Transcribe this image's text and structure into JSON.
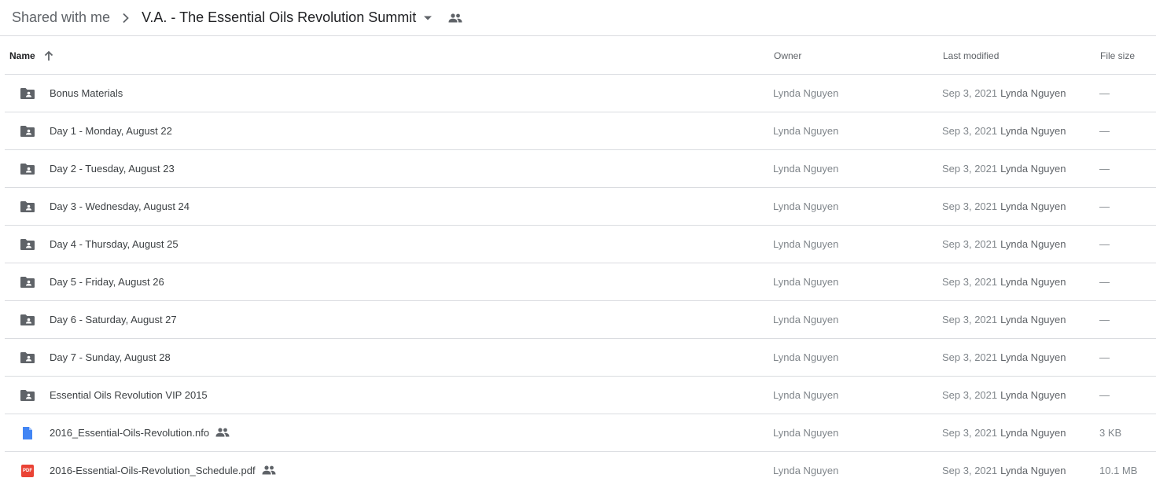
{
  "breadcrumb": {
    "root": "Shared with me",
    "current": "V.A. - The Essential Oils Revolution Summit",
    "icons": [
      "chevron-right-icon",
      "dropdown-arrow-icon",
      "shared-people-icon"
    ]
  },
  "table": {
    "headers": {
      "name": "Name",
      "owner": "Owner",
      "modified": "Last modified",
      "size": "File size"
    },
    "sort": "name-ascending",
    "rows": [
      {
        "type": "shared-folder",
        "name": "Bonus Materials",
        "shared": false,
        "owner": "Lynda Nguyen",
        "date": "Sep 3, 2021",
        "by": "Lynda Nguyen",
        "size": "—"
      },
      {
        "type": "shared-folder",
        "name": "Day 1 - Monday, August 22",
        "shared": false,
        "owner": "Lynda Nguyen",
        "date": "Sep 3, 2021",
        "by": "Lynda Nguyen",
        "size": "—"
      },
      {
        "type": "shared-folder",
        "name": "Day 2 - Tuesday, August 23",
        "shared": false,
        "owner": "Lynda Nguyen",
        "date": "Sep 3, 2021",
        "by": "Lynda Nguyen",
        "size": "—"
      },
      {
        "type": "shared-folder",
        "name": "Day 3 - Wednesday, August 24",
        "shared": false,
        "owner": "Lynda Nguyen",
        "date": "Sep 3, 2021",
        "by": "Lynda Nguyen",
        "size": "—"
      },
      {
        "type": "shared-folder",
        "name": "Day 4 - Thursday, August 25",
        "shared": false,
        "owner": "Lynda Nguyen",
        "date": "Sep 3, 2021",
        "by": "Lynda Nguyen",
        "size": "—"
      },
      {
        "type": "shared-folder",
        "name": "Day 5 - Friday, August 26",
        "shared": false,
        "owner": "Lynda Nguyen",
        "date": "Sep 3, 2021",
        "by": "Lynda Nguyen",
        "size": "—"
      },
      {
        "type": "shared-folder",
        "name": "Day 6 - Saturday, August 27",
        "shared": false,
        "owner": "Lynda Nguyen",
        "date": "Sep 3, 2021",
        "by": "Lynda Nguyen",
        "size": "—"
      },
      {
        "type": "shared-folder",
        "name": "Day 7 - Sunday, August 28",
        "shared": false,
        "owner": "Lynda Nguyen",
        "date": "Sep 3, 2021",
        "by": "Lynda Nguyen",
        "size": "—"
      },
      {
        "type": "shared-folder",
        "name": "Essential Oils Revolution VIP 2015",
        "shared": false,
        "owner": "Lynda Nguyen",
        "date": "Sep 3, 2021",
        "by": "Lynda Nguyen",
        "size": "—"
      },
      {
        "type": "doc-file",
        "name": "2016_Essential-Oils-Revolution.nfo",
        "shared": true,
        "owner": "Lynda Nguyen",
        "date": "Sep 3, 2021",
        "by": "Lynda Nguyen",
        "size": "3 KB"
      },
      {
        "type": "pdf-file",
        "name": "2016-Essential-Oils-Revolution_Schedule.pdf",
        "shared": true,
        "owner": "Lynda Nguyen",
        "date": "Sep 3, 2021",
        "by": "Lynda Nguyen",
        "size": "10.1 MB"
      }
    ]
  },
  "colors": {
    "folder": "#5f6368",
    "doc": "#4285f4",
    "pdf": "#ea4335",
    "border": "#dadce0",
    "muted_text": "#80868b"
  },
  "pdf_icon_text": "PDF"
}
